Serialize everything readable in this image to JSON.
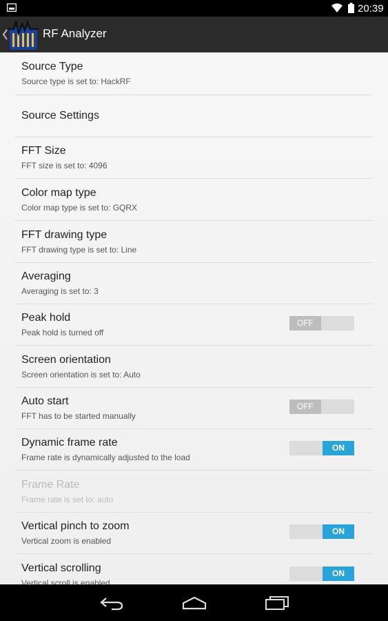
{
  "status": {
    "time": "20:39"
  },
  "app": {
    "title": "RF Analyzer"
  },
  "settings": [
    {
      "title": "Source Type",
      "summary": "Source type is set to: HackRF"
    },
    {
      "title": "Source Settings"
    },
    {
      "title": "FFT Size",
      "summary": "FFT size is set to: 4096"
    },
    {
      "title": "Color map type",
      "summary": "Color map type is set to: GQRX"
    },
    {
      "title": "FFT drawing type",
      "summary": "FFT drawing type is set to: Line"
    },
    {
      "title": "Averaging",
      "summary": "Averaging is set to: 3"
    },
    {
      "title": "Peak hold",
      "summary": "Peak hold is turned off",
      "toggle": "OFF"
    },
    {
      "title": "Screen orientation",
      "summary": "Screen orientation is set to: Auto"
    },
    {
      "title": "Auto start",
      "summary": "FFT has to be started manually",
      "toggle": "OFF"
    },
    {
      "title": "Dynamic frame rate",
      "summary": "Frame rate is dynamically adjusted to the load",
      "toggle": "ON"
    },
    {
      "title": "Frame Rate",
      "summary": "Frame rate is set to: auto"
    },
    {
      "title": "Vertical pinch to zoom",
      "summary": "Vertical zoom is enabled",
      "toggle": "ON"
    },
    {
      "title": "Vertical scrolling",
      "summary": "Vertical scroll is enabled",
      "toggle": "ON"
    }
  ],
  "colors": {
    "accent": "#2aa3d8",
    "action_bar": "#2b2b2b"
  },
  "icons": [
    "notification-icon",
    "wifi-icon",
    "battery-icon",
    "back-icon",
    "app-icon",
    "nav-back-icon",
    "nav-home-icon",
    "nav-recents-icon"
  ]
}
